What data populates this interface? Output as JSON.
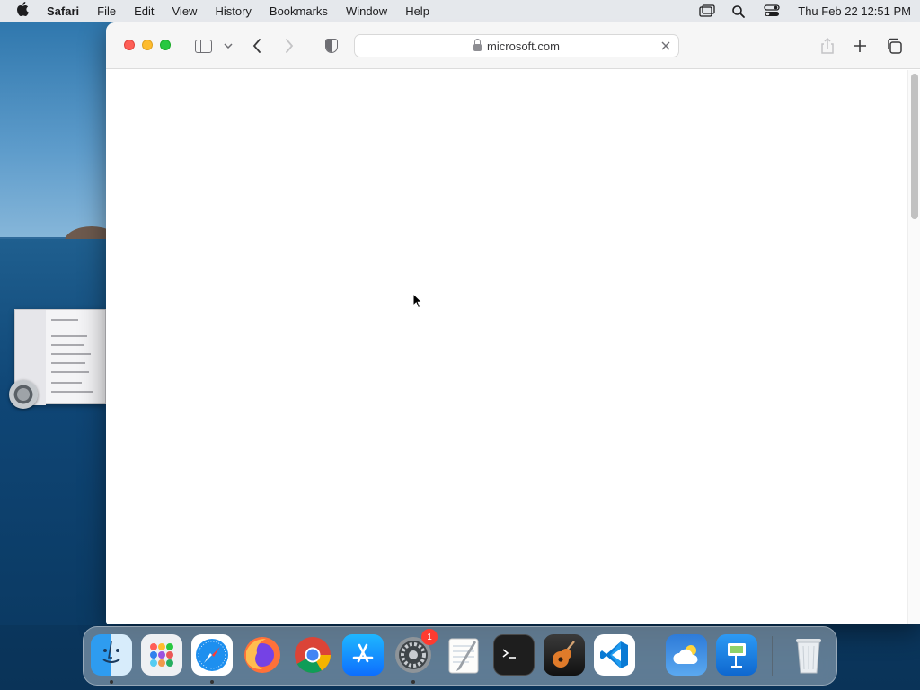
{
  "menubar": {
    "app_name": "Safari",
    "items": [
      "File",
      "Edit",
      "View",
      "History",
      "Bookmarks",
      "Window",
      "Help"
    ],
    "clock": "Thu Feb 22  12:51 PM",
    "status_icons": [
      "screen-mirroring-icon",
      "spotlight-search-icon",
      "control-center-icon"
    ]
  },
  "browser": {
    "url": "microsoft.com",
    "can_go_back": true,
    "can_go_forward": false
  },
  "dock": {
    "apps": [
      {
        "name": "Finder",
        "running": true
      },
      {
        "name": "Launchpad",
        "running": false
      },
      {
        "name": "Safari",
        "running": true
      },
      {
        "name": "Firefox",
        "running": false
      },
      {
        "name": "Chrome",
        "running": false
      },
      {
        "name": "App Store",
        "running": false
      },
      {
        "name": "System Preferences",
        "running": true,
        "badge": "1"
      },
      {
        "name": "TextEdit",
        "running": false
      },
      {
        "name": "Terminal",
        "running": false
      },
      {
        "name": "GarageBand",
        "running": false
      },
      {
        "name": "Visual Studio Code",
        "running": false
      },
      {
        "name": "Weather",
        "running": false
      },
      {
        "name": "Keynote",
        "running": false
      },
      {
        "name": "Trash",
        "running": false
      }
    ]
  }
}
